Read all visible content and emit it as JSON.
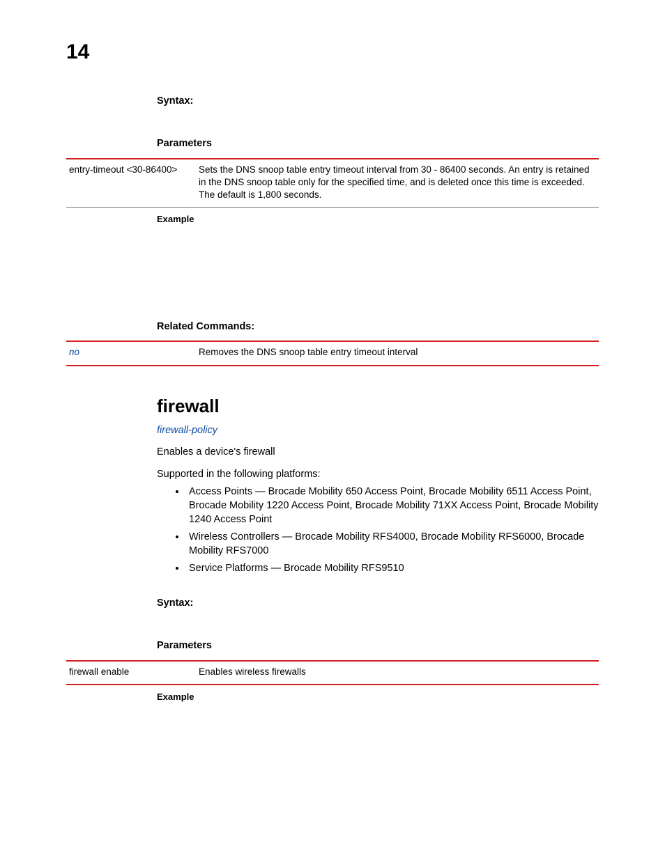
{
  "page_number": "14",
  "section1": {
    "syntax_label": "Syntax:",
    "parameters_label": "Parameters",
    "param_row": {
      "name": "entry-timeout <30-86400>",
      "desc": "Sets the DNS snoop table entry timeout interval from 30 - 86400 seconds. An entry is retained in the DNS snoop table only for the specified time, and is deleted once this time is exceeded. The default is 1,800 seconds."
    },
    "example_label": "Example",
    "related_label": "Related Commands:",
    "related_row": {
      "name": "no",
      "desc": "Removes the DNS snoop table entry timeout interval"
    }
  },
  "section2": {
    "heading": "firewall",
    "subheading_link": "firewall-policy",
    "intro": "Enables a device's firewall",
    "supported_intro": "Supported in the following platforms:",
    "bullets": [
      "Access Points — Brocade Mobility 650 Access Point, Brocade Mobility 6511 Access Point, Brocade Mobility 1220 Access Point, Brocade Mobility 71XX Access Point, Brocade Mobility 1240 Access Point",
      "Wireless Controllers — Brocade Mobility RFS4000, Brocade Mobility RFS6000, Brocade Mobility RFS7000",
      "Service Platforms — Brocade Mobility RFS9510"
    ],
    "syntax_label": "Syntax:",
    "parameters_label": "Parameters",
    "param_row": {
      "name": "firewall enable",
      "desc": "Enables wireless firewalls"
    },
    "example_label": "Example"
  }
}
